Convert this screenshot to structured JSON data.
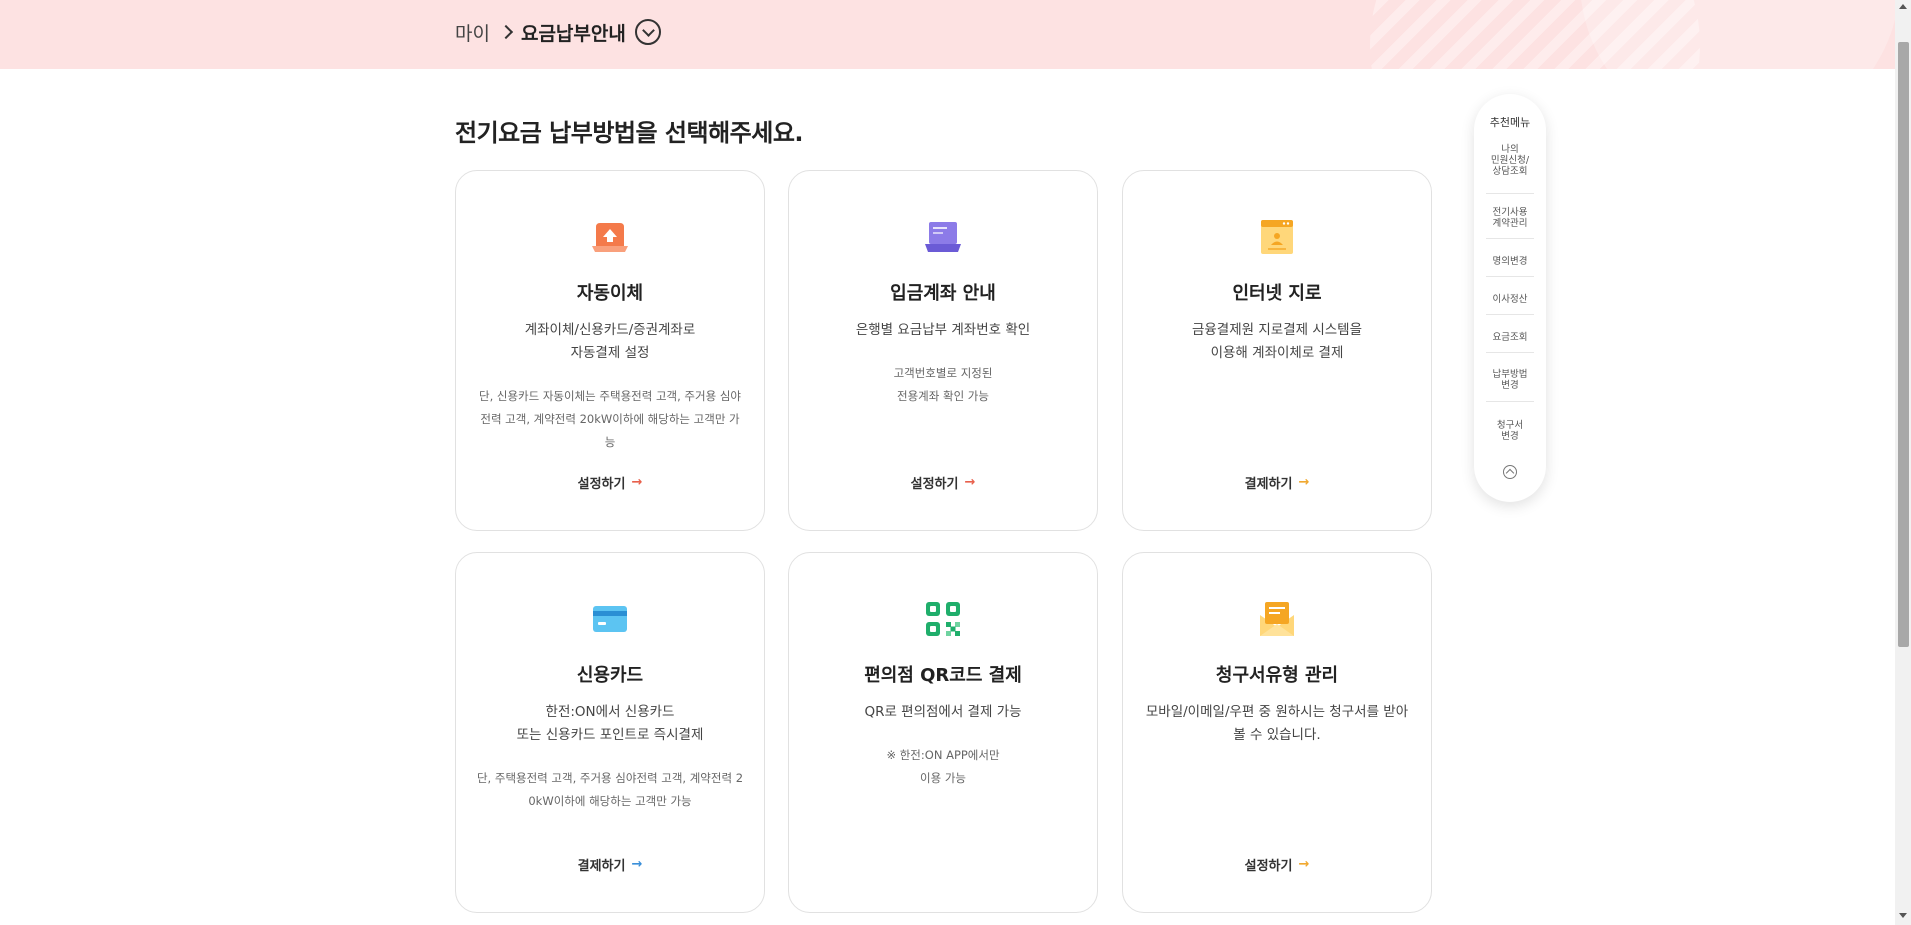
{
  "breadcrumb": {
    "home": "마이",
    "current": "요금납부안내"
  },
  "heading": "전기요금 납부방법을 선택해주세요.",
  "cards": [
    {
      "title": "자동이체",
      "desc_line1": "계좌이체/신용카드/증권계좌로",
      "desc_line2": "자동결제 설정",
      "note_line1": "단, 신용카드 자동이체는 주택용전력 고객, 주거용 심야",
      "note_line2": "전력 고객, 계약전력 20kW이하에 해당하는 고객만 가",
      "note_line3": "능",
      "action": "설정하기",
      "icon": "upload-icon",
      "arrow_color": "#e8604c"
    },
    {
      "title": "입금계좌 안내",
      "desc_line1": "은행별 요금납부 계좌번호 확인",
      "note_line1": "고객번호별로 지정된",
      "note_line2": "전용계좌 확인 가능",
      "action": "설정하기",
      "icon": "laptop-icon",
      "arrow_color": "#e8604c"
    },
    {
      "title": "인터넷 지로",
      "desc_line1": "금융결제원 지로결제 시스템을",
      "desc_line2": "이용해 계좌이체로 결제",
      "action": "결제하기",
      "icon": "browser-window-icon",
      "arrow_color": "#f0a830"
    },
    {
      "title": "신용카드",
      "desc_line1": "한전:ON에서 신용카드",
      "desc_line2": "또는 신용카드 포인트로 즉시결제",
      "note_line1": "단, 주택용전력 고객, 주거용 심야전력 고객, 계약전력 2",
      "note_line2": "0kW이하에 해당하는 고객만 가능",
      "action": "결제하기",
      "icon": "credit-card-icon",
      "arrow_color": "#3a8fd9"
    },
    {
      "title": "편의점 QR코드 결제",
      "desc_line1": "QR로 편의점에서 결제 가능",
      "note_line1": "※ 한전:ON APP에서만",
      "note_line2": "이용 가능",
      "icon": "qr-code-icon"
    },
    {
      "title": "청구서유형 관리",
      "desc_line1": "모바일/이메일/우편 중 원하시는 청구서를 받아",
      "desc_line2": "볼 수 있습니다.",
      "action": "설정하기",
      "icon": "envelope-icon",
      "arrow_color": "#f0a830"
    }
  ],
  "floating_menu": {
    "title": "추천메뉴",
    "items": [
      {
        "l1": "나의",
        "l2": "민원신청/",
        "l3": "상담조회"
      },
      {
        "l1": "전기사용",
        "l2": "계약관리"
      },
      {
        "l1": "명의변경"
      },
      {
        "l1": "이사정산"
      },
      {
        "l1": "요금조회"
      },
      {
        "l1": "납부방법",
        "l2": "변경"
      },
      {
        "l1": "청구서",
        "l2": "변경"
      }
    ]
  },
  "colors": {
    "header_bg": "#fde2e2",
    "card_border": "#e1e1e1"
  }
}
